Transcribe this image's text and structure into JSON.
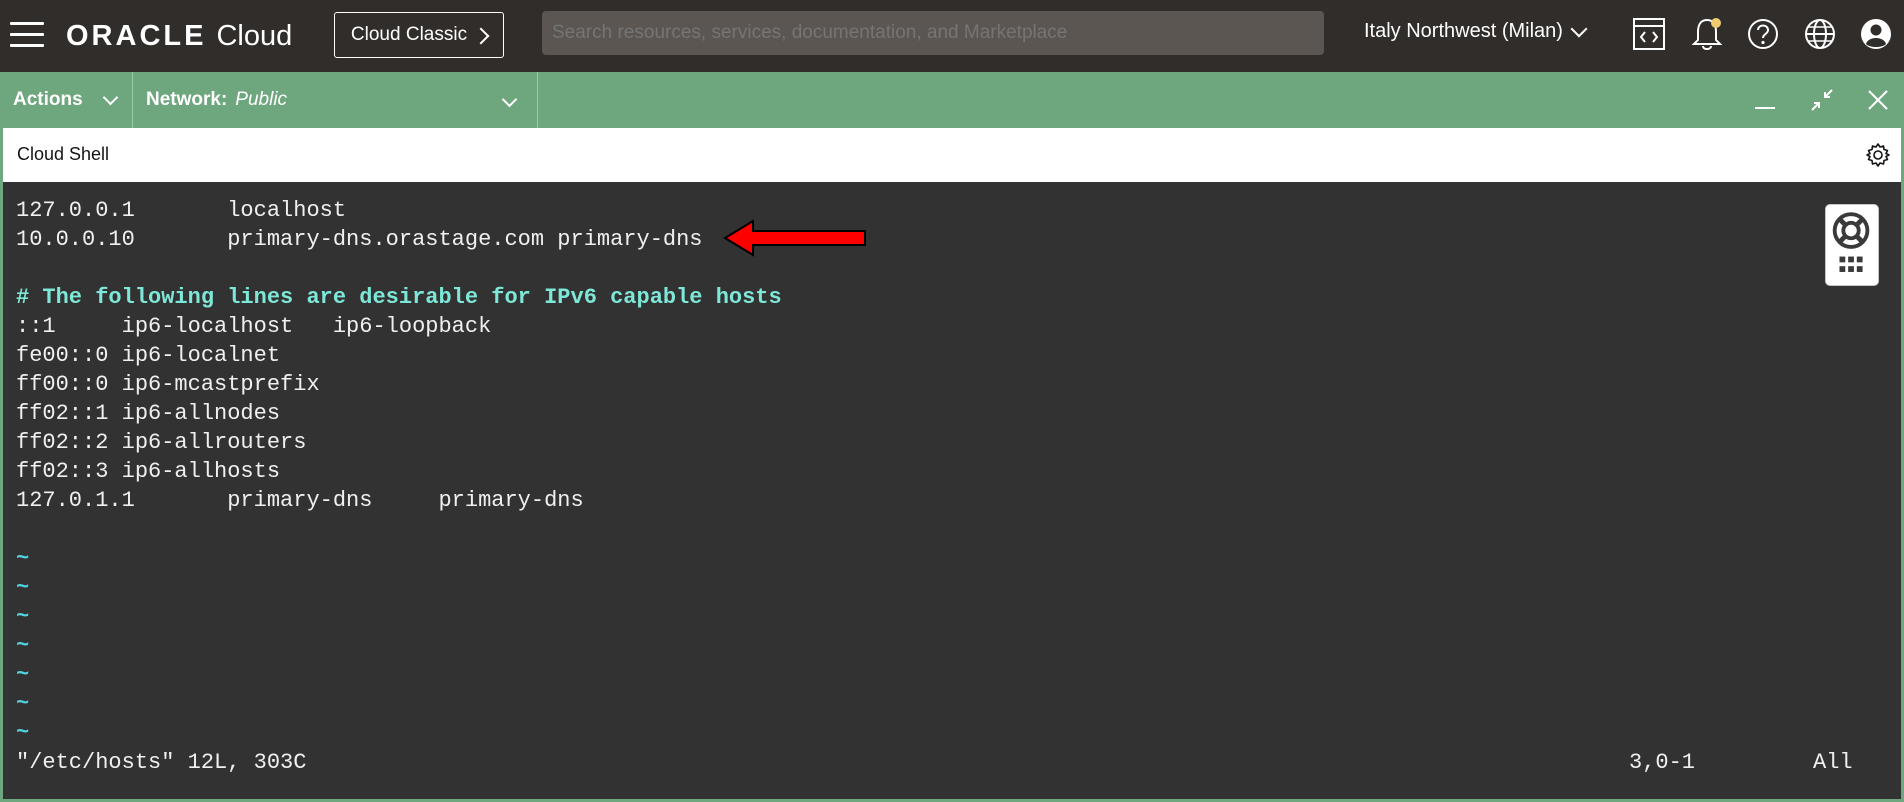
{
  "topbar": {
    "brand": "ORACLE",
    "product": "Cloud",
    "classic_button": "Cloud Classic",
    "search_placeholder": "Search resources, services, documentation, and Marketplace",
    "region": "Italy Northwest (Milan)",
    "icons": [
      "menu-icon",
      "code-editor-icon",
      "bell-icon",
      "help-icon",
      "globe-icon",
      "profile-icon"
    ],
    "notification_dot_color": "#f0cc71"
  },
  "shell_bar": {
    "actions_label": "Actions",
    "network_label": "Network:",
    "network_value": "Public",
    "background_color": "#6ea67e"
  },
  "shell_title": "Cloud Shell",
  "terminal": {
    "lines": [
      "127.0.0.1       localhost",
      "10.0.0.10       primary-dns.orastage.com primary-dns",
      "",
      "# The following lines are desirable for IPv6 capable hosts",
      "::1     ip6-localhost   ip6-loopback",
      "fe00::0 ip6-localnet",
      "ff00::0 ip6-mcastprefix",
      "ff02::1 ip6-allnodes",
      "ff02::2 ip6-allrouters",
      "ff02::3 ip6-allhosts",
      "127.0.1.1       primary-dns     primary-dns",
      "",
      "~",
      "~",
      "~",
      "~",
      "~",
      "~",
      "~"
    ],
    "status_left": "\"/etc/hosts\" 12L, 303C",
    "status_position": "3,0-1",
    "status_scroll": "All",
    "arrow_color": "#ff0000"
  }
}
